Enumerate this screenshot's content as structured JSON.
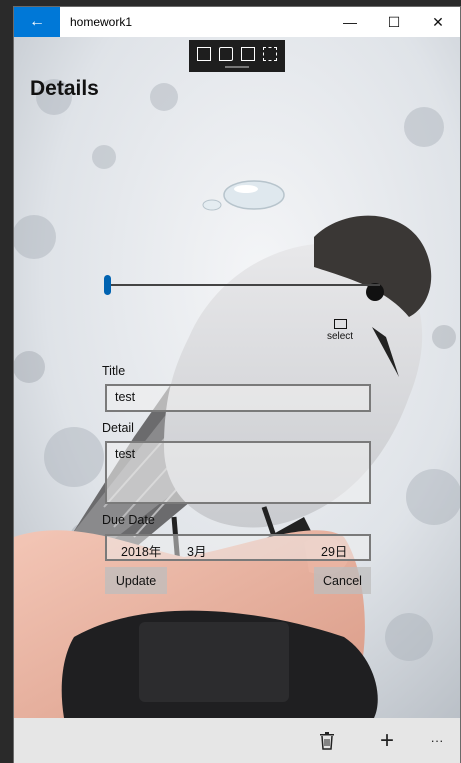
{
  "window": {
    "app_title": "homework1",
    "back_glyph": "←",
    "minimize_glyph": "—",
    "maximize_glyph": "☐",
    "close_glyph": "✕"
  },
  "page": {
    "title": "Details"
  },
  "debug_toolbar": {
    "icons": [
      "live-tree-icon",
      "select-element-icon",
      "display-layout-adorners-icon",
      "track-focus-icon"
    ]
  },
  "slider": {
    "value_fraction": 0.0
  },
  "select_button": {
    "label": "select",
    "icon": "select-icon"
  },
  "form": {
    "title_label": "Title",
    "title_value": "test",
    "detail_label": "Detail",
    "detail_value": "test",
    "due_date_label": "Due Date",
    "due_year": "2018年",
    "due_month": "3月",
    "due_day": "29日",
    "update_label": "Update",
    "cancel_label": "Cancel"
  },
  "command_bar": {
    "delete_icon": "trash-icon",
    "add_glyph": "+",
    "more_glyph": "···"
  },
  "colors": {
    "accent": "#0078d7",
    "slider_thumb": "#0063b1"
  }
}
